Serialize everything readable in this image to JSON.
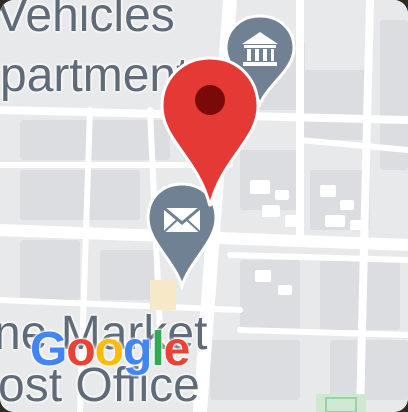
{
  "map": {
    "labels": {
      "top_line_1": "Vehicles",
      "top_line_2": "partment",
      "bottom_line_1": "ne Market",
      "bottom_line_2": "ost Office"
    },
    "logo": {
      "letters": [
        "G",
        "o",
        "o",
        "g",
        "l",
        "e"
      ],
      "colors": [
        "#4285F4",
        "#EA4335",
        "#FBBC05",
        "#4285F4",
        "#34A853",
        "#EA4335"
      ]
    },
    "markers": {
      "location_pin": {
        "icon": "location-pin-icon",
        "color": "#e53935"
      },
      "government_building": {
        "icon": "bank-building-icon",
        "color": "#6f8192"
      },
      "post_office": {
        "icon": "envelope-icon",
        "color": "#6f8192"
      }
    }
  }
}
